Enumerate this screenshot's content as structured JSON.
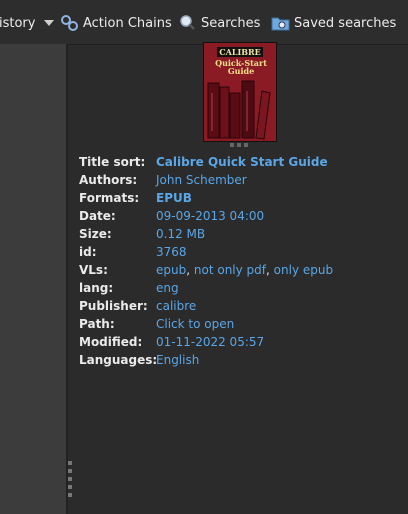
{
  "toolbar": {
    "history_label": "istory",
    "action_chains_label": "Action Chains",
    "searches_label": "Searches",
    "saved_searches_label": "Saved searches"
  },
  "cover": {
    "badge": "CALIBRE",
    "title_line1": "Quick-Start",
    "title_line2": "Guide"
  },
  "details": {
    "title_sort_label": "Title sort:",
    "title_sort": "Calibre Quick Start Guide",
    "authors_label": "Authors:",
    "authors": "John Schember",
    "formats_label": "Formats:",
    "formats": "EPUB",
    "date_label": "Date:",
    "date": "09-09-2013 04:00",
    "size_label": "Size:",
    "size": "0.12 MB",
    "id_label": "id:",
    "id": "3768",
    "vls_label": "VLs:",
    "vls": [
      "epub",
      "not only pdf",
      "only epub"
    ],
    "vls_sep": ",",
    "lang_label": "lang:",
    "lang": "eng",
    "publisher_label": "Publisher:",
    "publisher": "calibre",
    "path_label": "Path:",
    "path": "Click to open",
    "modified_label": "Modified:",
    "modified": "01-11-2022 05:57",
    "languages_label": "Languages:",
    "languages": "English"
  },
  "colors": {
    "link": "#5aa6e6",
    "label": "#eaeaea",
    "background": "#2b2b2b",
    "left_panel": "#3c3c3c"
  }
}
